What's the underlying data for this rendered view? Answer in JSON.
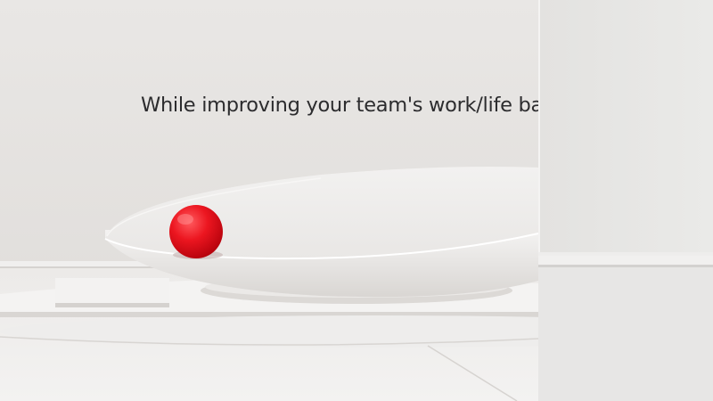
{
  "caption": {
    "text": "While improving your team's work/life balance"
  },
  "colors": {
    "background": "#e6e4e2",
    "ball_accent": "#e8101a",
    "caption_text": "#2c2c2e"
  }
}
